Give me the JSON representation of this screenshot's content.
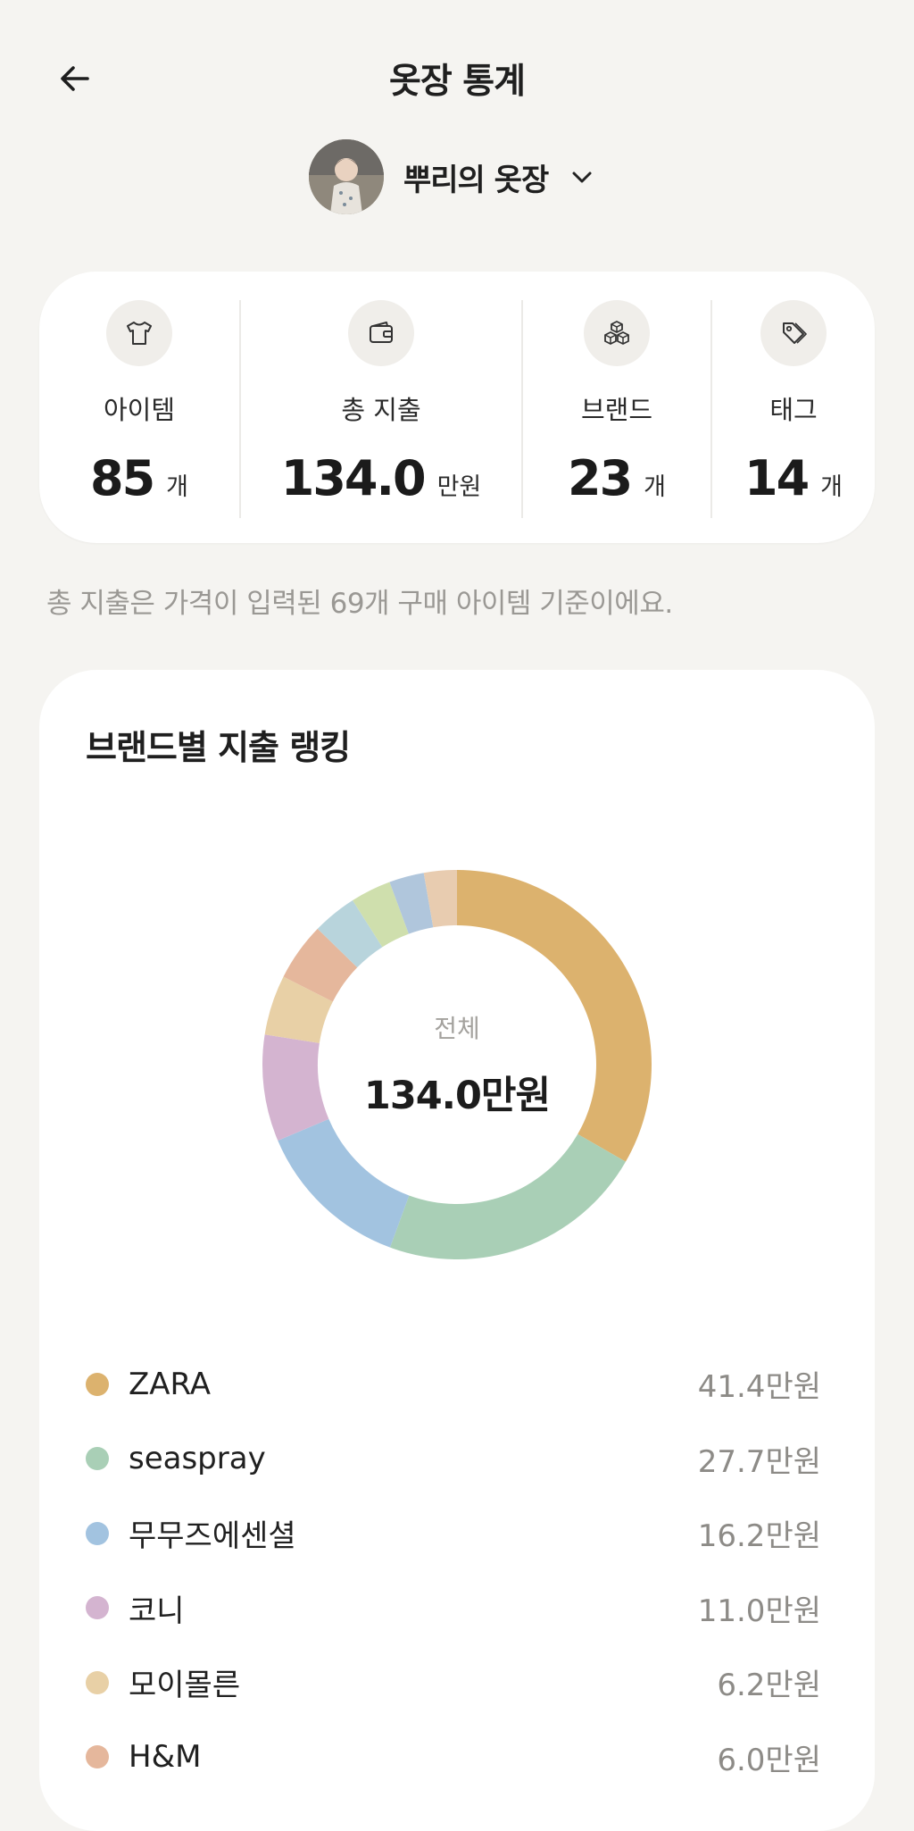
{
  "header": {
    "title": "옷장 통계",
    "back_icon": "arrow-left-icon"
  },
  "closet": {
    "name": "뿌리의 옷장",
    "dropdown_icon": "chevron-down-icon"
  },
  "stats": [
    {
      "icon": "tshirt-icon",
      "label": "아이템",
      "value": "85",
      "unit": "개"
    },
    {
      "icon": "wallet-icon",
      "label": "총 지출",
      "value": "134.0",
      "unit": "만원"
    },
    {
      "icon": "boxes-icon",
      "label": "브랜드",
      "value": "23",
      "unit": "개"
    },
    {
      "icon": "tag-icon",
      "label": "태그",
      "value": "14",
      "unit": "개"
    }
  ],
  "note": "총 지출은 가격이 입력된 69개 구매 아이템 기준이에요.",
  "ranking": {
    "title": "브랜드별 지출 랭킹",
    "center_label": "전체",
    "center_value": "134.0만원"
  },
  "chart_data": {
    "type": "pie",
    "title": "브랜드별 지출 랭킹",
    "total": 134.0,
    "unit": "만원",
    "categories": [
      "ZARA",
      "seaspray",
      "무무즈에센셜",
      "코니",
      "모이몰른",
      "H&M"
    ],
    "values": [
      41.4,
      27.7,
      16.2,
      11.0,
      6.2,
      6.0
    ],
    "value_labels": [
      "41.4만원",
      "27.7만원",
      "16.2만원",
      "11.0만원",
      "6.2만원",
      "6.0만원"
    ],
    "colors": [
      "#dcb26e",
      "#a9cfb6",
      "#a2c3e0",
      "#d4b4d0",
      "#e8d0a6",
      "#e5b79c"
    ],
    "other_values": [
      4.6,
      4.2,
      3.6,
      3.4
    ],
    "other_colors": [
      "#b8d4dc",
      "#cfdfad",
      "#b0c6dc",
      "#e8ccb0"
    ]
  }
}
